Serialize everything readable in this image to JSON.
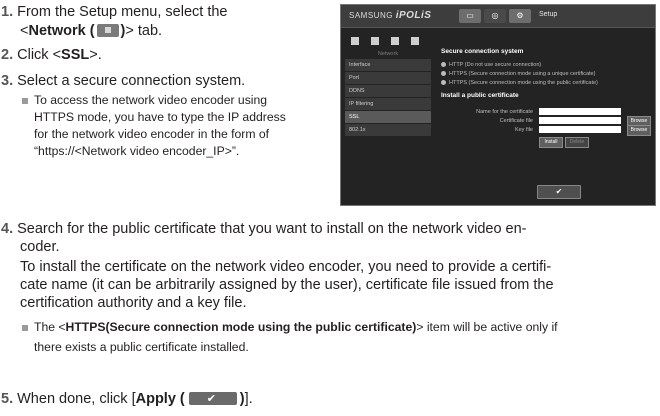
{
  "steps": {
    "s1": {
      "num": "1.",
      "line1": "From the Setup menu, select the",
      "line2_pre": "<",
      "line2_bold": "Network (",
      "line2_bold2": ")",
      "line2_post": "> tab."
    },
    "s2": {
      "num": "2.",
      "pre": "Click <",
      "bold": "SSL",
      "post": ">."
    },
    "s3": {
      "num": "3.",
      "text": "Select a secure connection system."
    },
    "note3": {
      "l1": "To access the network video encoder using",
      "l2": "HTTPS mode, you have to type the IP address",
      "l3": "for the network video encoder in the form of",
      "l4": "“https://<Network video encoder_IP>”."
    },
    "s4": {
      "num": "4.",
      "l1": "Search for the public certificate that you want to install on the network video en-",
      "l2": "coder.",
      "l3": "To install the certificate on the network video encoder, you need to provide a certifi-",
      "l4": "cate name (it can be arbitrarily assigned by the user), certificate file issued from the",
      "l5": "certification authority and a key file."
    },
    "note4": {
      "pre": "The <",
      "bold": "HTTPS(Secure connection mode using the public certificate)",
      "post": "> item will be active only if",
      "l2": "there exists a public certificate installed."
    },
    "s5": {
      "num": "5.",
      "pre": "When done, click [",
      "bold": "Apply (",
      "bold2": ")",
      "post": "]."
    }
  },
  "screenshot": {
    "brand_samsung": "SAMSUNG",
    "brand_ipolis": "iPOLiS",
    "header_setup": "Setup",
    "sidebar_heading": "Network",
    "menu": [
      "Interface",
      "Port",
      "DDNS",
      "IP filtering",
      "SSL",
      "802.1x"
    ],
    "section1_title": "Secure connection system",
    "radios": [
      "HTTP (Do not use secure connection)",
      "HTTPS (Secure connection mode using a unique certificate)",
      "HTTPS (Secure connection mode using the public certificate)"
    ],
    "section2_title": "Install a public certificate",
    "label_name": "Name for the certificate",
    "label_cert": "Certificate file",
    "label_key": "Key file",
    "browse": "Browse",
    "install": "Install",
    "delete": "Delete"
  }
}
